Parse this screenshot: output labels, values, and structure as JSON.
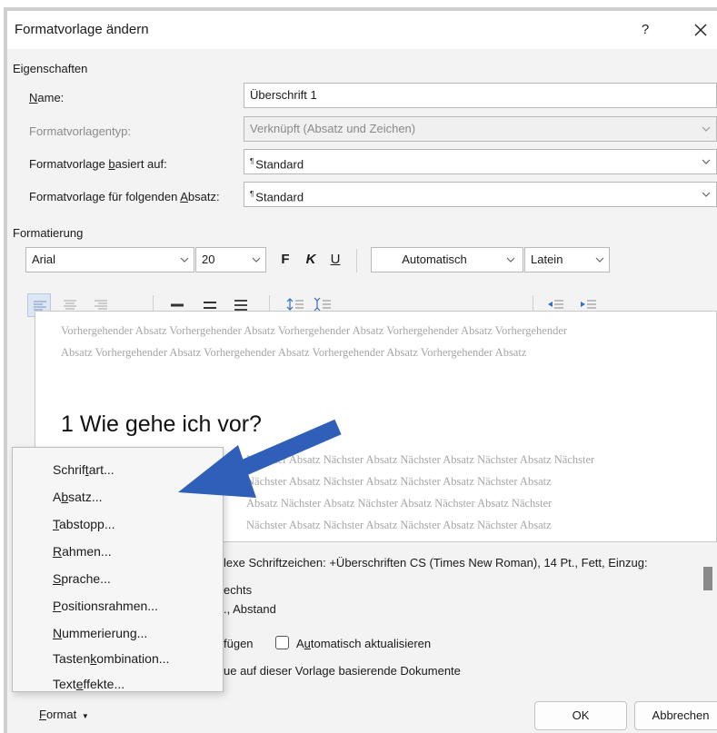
{
  "dialog": {
    "title": "Formatvorlage ändern",
    "help_label": "?"
  },
  "properties": {
    "section_label": "Eigenschaften",
    "name_label": "Name:",
    "name_value": "Überschrift 1",
    "type_label": "Formatvorlagentyp:",
    "type_value": "Verknüpft (Absatz und Zeichen)",
    "based_on_label": "Formatvorlage basiert auf:",
    "based_on_value": "Standard",
    "next_label": "Formatvorlage für folgenden Absatz:",
    "next_value": "Standard",
    "para_mark": "¶"
  },
  "formatting": {
    "section_label": "Formatierung",
    "font": "Arial",
    "size": "20",
    "bold_label": "F",
    "italic_label": "K",
    "underline_label": "U",
    "color": "Automatisch",
    "script": "Latein"
  },
  "preview": {
    "previous_line1": "Vorhergehender Absatz Vorhergehender Absatz Vorhergehender Absatz Vorhergehender Absatz Vorhergehender",
    "previous_line2": "Absatz Vorhergehender Absatz Vorhergehender Absatz Vorhergehender Absatz Vorhergehender Absatz",
    "heading": "1  Wie gehe ich vor?",
    "next_line1": "Nächster Absatz Nächster Absatz Nächster Absatz Nächster Absatz Nächster",
    "next_line2": "Nächster Absatz Nächster Absatz Nächster Absatz Nächster Absatz",
    "next_line3": "Absatz Nächster Absatz Nächster Absatz Nächster Absatz Nächster",
    "next_line4": "Nächster Absatz Nächster Absatz Nächster Absatz Nächster Absatz"
  },
  "description": {
    "line1": "lexe Schriftzeichen: +Überschriften CS (Times New Roman), 14 Pt., Fett, Einzug:",
    "line2": "echts",
    "line3": "., Abstand"
  },
  "options": {
    "add_gallery_partial": "fügen",
    "auto_update": "Automatisch aktualisieren",
    "new_docs_partial": "ue auf dieser Vorlage basierende Dokumente"
  },
  "buttons": {
    "format": "Format",
    "ok": "OK",
    "cancel": "Abbrechen"
  },
  "format_menu": {
    "items": [
      "Schriftart...",
      "Absatz...",
      "Tabstopp...",
      "Rahmen...",
      "Sprache...",
      "Positionsrahmen...",
      "Nummerierung...",
      "Tastenkombination...",
      "Texteffekte..."
    ]
  },
  "colors": {
    "arrow": "#2f5fb8",
    "preview_gray": "#a6a6a6",
    "dialog_bg": "#f3f3f3"
  }
}
